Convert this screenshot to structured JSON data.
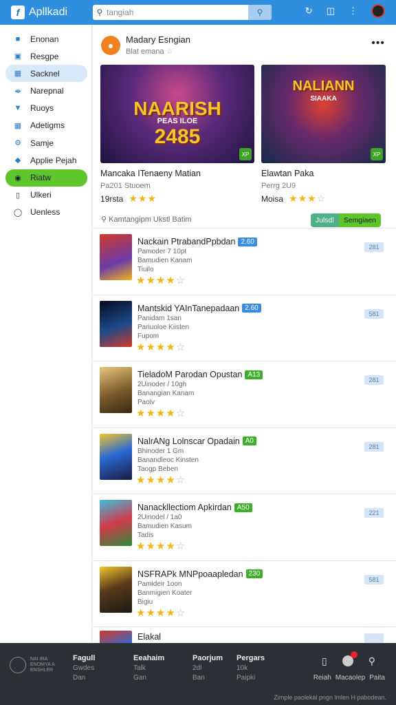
{
  "header": {
    "logo_letter": "f",
    "app_title": "Apllkadi",
    "search_placeholder": "tangiah",
    "search_button_icon": "magnifier-icon",
    "icons": [
      "refresh-icon",
      "feedback-icon",
      "more-vertical-icon"
    ]
  },
  "sidebar": {
    "items": [
      {
        "label": "Enonan",
        "icon": "home-icon",
        "state": ""
      },
      {
        "label": "Resgpe",
        "icon": "recipe-icon",
        "state": ""
      },
      {
        "label": "Sacknel",
        "icon": "grid-icon",
        "state": "selected"
      },
      {
        "label": "Narepnal",
        "icon": "link-icon",
        "state": ""
      },
      {
        "label": "Ruoys",
        "icon": "wifi-icon",
        "state": ""
      },
      {
        "label": "Adetigms",
        "icon": "apps-icon",
        "state": ""
      },
      {
        "label": "Samje",
        "icon": "gear-icon",
        "state": ""
      },
      {
        "label": "Applie Pejah",
        "icon": "tag-icon",
        "state": ""
      },
      {
        "label": "Riatw",
        "icon": "controller-icon",
        "state": "highlight"
      },
      {
        "label": "Ulkeri",
        "icon": "document-icon",
        "state": ""
      },
      {
        "label": "Uenless",
        "icon": "help-icon",
        "state": ""
      }
    ]
  },
  "featured": {
    "developer_title": "Madary Esngian",
    "developer_sub": "Blat emana",
    "more_label": "•••",
    "cards": [
      {
        "art_line1": "NAARISH",
        "art_line2": "2485",
        "art_sub": "PEAS ILOE",
        "corner": "XP",
        "title": "Mancaka ITenaeny Matian",
        "sub": "Pa201 Stuoem",
        "rating_label": "19rsta",
        "stars": 3
      },
      {
        "art_line1": "NALIANN",
        "art_line2": "",
        "art_sub": "SIAAKA",
        "corner": "XP",
        "title": "Elawtan Paka",
        "sub": "Perrg 2U9",
        "rating_label": "Moisa",
        "stars": 3
      }
    ]
  },
  "filter": {
    "text": "Kamtangipm Ukstl Batim",
    "seg1": "Julsdl",
    "seg2": "Semgiaen"
  },
  "list": [
    {
      "title": "Nackain PtrabandPpbdan",
      "badge": "2.60",
      "badge_color": "b",
      "l1": "Pamoder 7 10pt",
      "l2": "Bamudien Kanam",
      "l3": "Tiuilo",
      "stars": 4,
      "btn": "281"
    },
    {
      "title": "Mantskid YAInTanepadaan",
      "badge": "2.60",
      "badge_color": "b",
      "l1": "Panidam 1san",
      "l2": "Pariuoloe Kiisten",
      "l3": "Fupom",
      "stars": 4,
      "btn": "581"
    },
    {
      "title": "TieladoM Parodan Opustan",
      "badge": "A13",
      "badge_color": "g",
      "l1": "2Uinoder / 10gh",
      "l2": "Banangian Kanam",
      "l3": "Paolv",
      "stars": 4,
      "btn": "281"
    },
    {
      "title": "NalrANg Lolnscar Opadain",
      "badge": "A0",
      "badge_color": "g",
      "l1": "Bhinoder 1 Gm",
      "l2": "Banandleoc Kinsten",
      "l3": "Taogp Beben",
      "stars": 4,
      "btn": "281"
    },
    {
      "title": "Nanackllectiom Apkirdan",
      "badge": "A50",
      "badge_color": "g",
      "l1": "2Uinodel / 1a0",
      "l2": "Bamudien Kasum",
      "l3": "Tadis",
      "stars": 4,
      "btn": "221"
    },
    {
      "title": "NSFRAPk MNPpoaapledan",
      "badge": "230",
      "badge_color": "g",
      "l1": "Pamideir 1oon",
      "l2": "Banmigien Koater",
      "l3": "Bigiu",
      "stars": 4,
      "btn": "581"
    }
  ],
  "last_item_title": "Elakal",
  "bottom": {
    "brand_text": "NAI IRA ENOMYA A ENSHLER",
    "columns": [
      {
        "h": "Fagull",
        "l1": "Gwdes",
        "l2": "Dan"
      },
      {
        "h": "Eeahaim",
        "l1": "Talk",
        "l2": "Gan"
      },
      {
        "h": "Paorjum",
        "l1": "2dl",
        "l2": "Ban"
      },
      {
        "h": "Pergars",
        "l1": "10k",
        "l2": "Paipki"
      }
    ],
    "icon_labels": [
      "Reiah",
      "Macaolep",
      "Paita"
    ],
    "footnote": "Zimple paolekal pngn lmlen H pabodean."
  }
}
